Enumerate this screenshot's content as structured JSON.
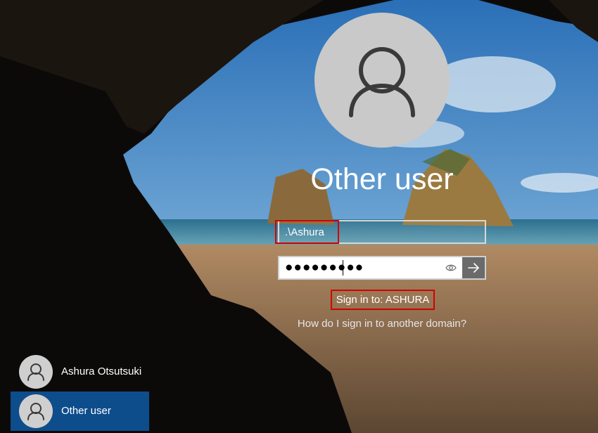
{
  "login": {
    "title": "Other user",
    "username_value": ".\\Ashura",
    "password_mask": "●●●●●●●●●",
    "sign_in_to": "Sign in to: ASHURA",
    "domain_help_link": "How do I sign in to another domain?"
  },
  "users": [
    {
      "label": "Ashura Otsutsuki",
      "selected": false
    },
    {
      "label": "Other user",
      "selected": true
    }
  ],
  "colors": {
    "selected_tile": "#0e4d8c",
    "highlight_box": "#d40000",
    "submit_button": "#6b6b6b"
  },
  "icons": [
    "user-avatar-icon",
    "reveal-password-icon",
    "arrow-right-icon"
  ]
}
